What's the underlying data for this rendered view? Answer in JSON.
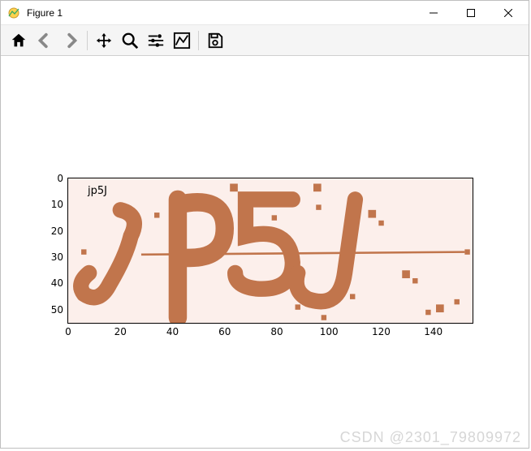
{
  "window": {
    "title": "Figure 1"
  },
  "toolbar": {
    "home": "Home",
    "back": "Back",
    "forward": "Forward",
    "pan": "Pan",
    "zoom": "Zoom",
    "subplots": "Configure subplots",
    "axes": "Edit axes",
    "save": "Save"
  },
  "chart_data": {
    "type": "image",
    "title": "jp5J",
    "xlabel": "",
    "ylabel": "",
    "xlim": [
      0,
      155
    ],
    "ylim": [
      55,
      0
    ],
    "x_ticks": [
      0,
      20,
      40,
      60,
      80,
      100,
      120,
      140
    ],
    "y_ticks": [
      0,
      10,
      20,
      30,
      40,
      50
    ],
    "image_description": "captcha showing letters j p 5 J in dark orange on light pink background with noise speckles and a thin horizontal noise line",
    "captcha_text": "jp5J",
    "stroke_color": "#c1754c",
    "background_color": "#fcefeb"
  },
  "watermark": "CSDN @2301_79809972"
}
